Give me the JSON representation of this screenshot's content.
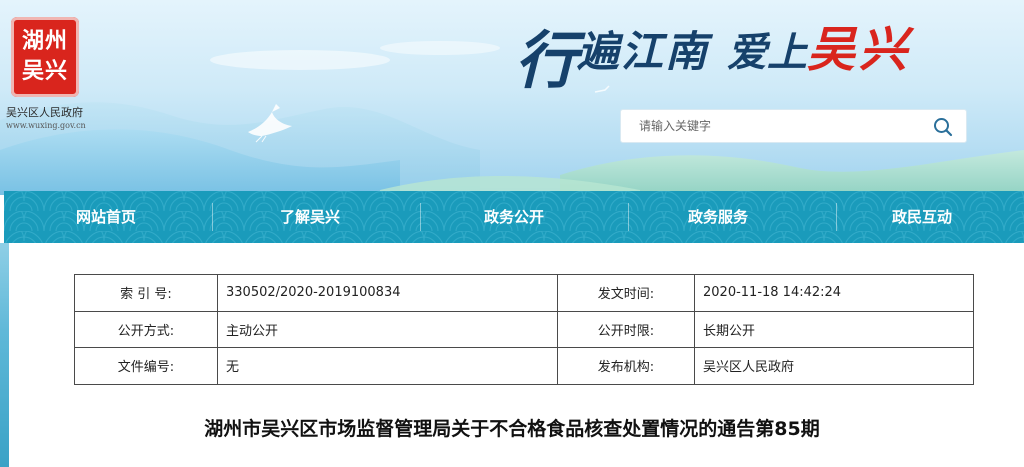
{
  "header": {
    "logo_line1": "湖州",
    "logo_line2": "吴兴",
    "gov_name": "吴兴区人民政府",
    "gov_url": "www.wuxing.gov.cn",
    "slogan_part1": "行",
    "slogan_part2": "遍江南",
    "slogan_part3": "爱上",
    "slogan_part4": "吴兴"
  },
  "search": {
    "placeholder": "请输入关键字",
    "icon": "search-icon"
  },
  "nav": {
    "items": [
      {
        "label": "网站首页"
      },
      {
        "label": "了解吴兴"
      },
      {
        "label": "政务公开"
      },
      {
        "label": "政务服务"
      },
      {
        "label": "政民互动"
      }
    ]
  },
  "info": {
    "rows": [
      {
        "label1": "索 引 号:",
        "value1": "330502/2020-2019100834",
        "label2": "发文时间:",
        "value2": "2020-11-18 14:42:24"
      },
      {
        "label1": "公开方式:",
        "value1": "主动公开",
        "label2": "公开时限:",
        "value2": "长期公开"
      },
      {
        "label1": "文件编号:",
        "value1": "无",
        "label2": "发布机构:",
        "value2": "吴兴区人民政府"
      }
    ]
  },
  "document": {
    "title": "湖州市吴兴区市场监督管理局关于不合格食品核查处置情况的通告第85期"
  },
  "colors": {
    "nav_bg": "#1a9bbb",
    "seal_red": "#d9251d",
    "slogan_blue": "#16416b"
  }
}
